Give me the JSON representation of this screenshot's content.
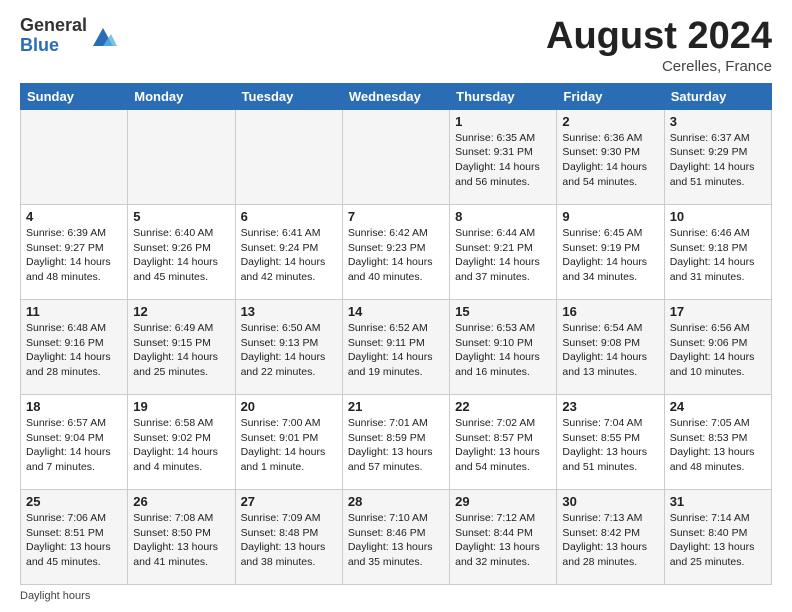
{
  "header": {
    "logo_general": "General",
    "logo_blue": "Blue",
    "month_title": "August 2024",
    "location": "Cerelles, France"
  },
  "footer": {
    "daylight_label": "Daylight hours"
  },
  "days_of_week": [
    "Sunday",
    "Monday",
    "Tuesday",
    "Wednesday",
    "Thursday",
    "Friday",
    "Saturday"
  ],
  "weeks": [
    [
      {
        "day": "",
        "info": ""
      },
      {
        "day": "",
        "info": ""
      },
      {
        "day": "",
        "info": ""
      },
      {
        "day": "",
        "info": ""
      },
      {
        "day": "1",
        "info": "Sunrise: 6:35 AM\nSunset: 9:31 PM\nDaylight: 14 hours\nand 56 minutes."
      },
      {
        "day": "2",
        "info": "Sunrise: 6:36 AM\nSunset: 9:30 PM\nDaylight: 14 hours\nand 54 minutes."
      },
      {
        "day": "3",
        "info": "Sunrise: 6:37 AM\nSunset: 9:29 PM\nDaylight: 14 hours\nand 51 minutes."
      }
    ],
    [
      {
        "day": "4",
        "info": "Sunrise: 6:39 AM\nSunset: 9:27 PM\nDaylight: 14 hours\nand 48 minutes."
      },
      {
        "day": "5",
        "info": "Sunrise: 6:40 AM\nSunset: 9:26 PM\nDaylight: 14 hours\nand 45 minutes."
      },
      {
        "day": "6",
        "info": "Sunrise: 6:41 AM\nSunset: 9:24 PM\nDaylight: 14 hours\nand 42 minutes."
      },
      {
        "day": "7",
        "info": "Sunrise: 6:42 AM\nSunset: 9:23 PM\nDaylight: 14 hours\nand 40 minutes."
      },
      {
        "day": "8",
        "info": "Sunrise: 6:44 AM\nSunset: 9:21 PM\nDaylight: 14 hours\nand 37 minutes."
      },
      {
        "day": "9",
        "info": "Sunrise: 6:45 AM\nSunset: 9:19 PM\nDaylight: 14 hours\nand 34 minutes."
      },
      {
        "day": "10",
        "info": "Sunrise: 6:46 AM\nSunset: 9:18 PM\nDaylight: 14 hours\nand 31 minutes."
      }
    ],
    [
      {
        "day": "11",
        "info": "Sunrise: 6:48 AM\nSunset: 9:16 PM\nDaylight: 14 hours\nand 28 minutes."
      },
      {
        "day": "12",
        "info": "Sunrise: 6:49 AM\nSunset: 9:15 PM\nDaylight: 14 hours\nand 25 minutes."
      },
      {
        "day": "13",
        "info": "Sunrise: 6:50 AM\nSunset: 9:13 PM\nDaylight: 14 hours\nand 22 minutes."
      },
      {
        "day": "14",
        "info": "Sunrise: 6:52 AM\nSunset: 9:11 PM\nDaylight: 14 hours\nand 19 minutes."
      },
      {
        "day": "15",
        "info": "Sunrise: 6:53 AM\nSunset: 9:10 PM\nDaylight: 14 hours\nand 16 minutes."
      },
      {
        "day": "16",
        "info": "Sunrise: 6:54 AM\nSunset: 9:08 PM\nDaylight: 14 hours\nand 13 minutes."
      },
      {
        "day": "17",
        "info": "Sunrise: 6:56 AM\nSunset: 9:06 PM\nDaylight: 14 hours\nand 10 minutes."
      }
    ],
    [
      {
        "day": "18",
        "info": "Sunrise: 6:57 AM\nSunset: 9:04 PM\nDaylight: 14 hours\nand 7 minutes."
      },
      {
        "day": "19",
        "info": "Sunrise: 6:58 AM\nSunset: 9:02 PM\nDaylight: 14 hours\nand 4 minutes."
      },
      {
        "day": "20",
        "info": "Sunrise: 7:00 AM\nSunset: 9:01 PM\nDaylight: 14 hours\nand 1 minute."
      },
      {
        "day": "21",
        "info": "Sunrise: 7:01 AM\nSunset: 8:59 PM\nDaylight: 13 hours\nand 57 minutes."
      },
      {
        "day": "22",
        "info": "Sunrise: 7:02 AM\nSunset: 8:57 PM\nDaylight: 13 hours\nand 54 minutes."
      },
      {
        "day": "23",
        "info": "Sunrise: 7:04 AM\nSunset: 8:55 PM\nDaylight: 13 hours\nand 51 minutes."
      },
      {
        "day": "24",
        "info": "Sunrise: 7:05 AM\nSunset: 8:53 PM\nDaylight: 13 hours\nand 48 minutes."
      }
    ],
    [
      {
        "day": "25",
        "info": "Sunrise: 7:06 AM\nSunset: 8:51 PM\nDaylight: 13 hours\nand 45 minutes."
      },
      {
        "day": "26",
        "info": "Sunrise: 7:08 AM\nSunset: 8:50 PM\nDaylight: 13 hours\nand 41 minutes."
      },
      {
        "day": "27",
        "info": "Sunrise: 7:09 AM\nSunset: 8:48 PM\nDaylight: 13 hours\nand 38 minutes."
      },
      {
        "day": "28",
        "info": "Sunrise: 7:10 AM\nSunset: 8:46 PM\nDaylight: 13 hours\nand 35 minutes."
      },
      {
        "day": "29",
        "info": "Sunrise: 7:12 AM\nSunset: 8:44 PM\nDaylight: 13 hours\nand 32 minutes."
      },
      {
        "day": "30",
        "info": "Sunrise: 7:13 AM\nSunset: 8:42 PM\nDaylight: 13 hours\nand 28 minutes."
      },
      {
        "day": "31",
        "info": "Sunrise: 7:14 AM\nSunset: 8:40 PM\nDaylight: 13 hours\nand 25 minutes."
      }
    ]
  ]
}
